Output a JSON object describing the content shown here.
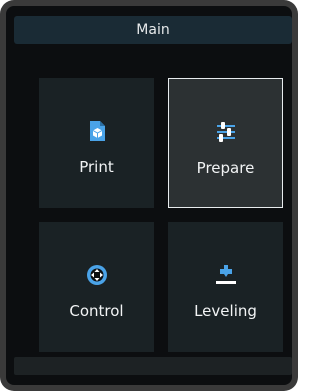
{
  "header": {
    "title": "Main"
  },
  "tiles": [
    {
      "label": "Print",
      "icon": "print-file-icon"
    },
    {
      "label": "Prepare",
      "icon": "sliders-icon",
      "selected": true
    },
    {
      "label": "Control",
      "icon": "dpad-icon"
    },
    {
      "label": "Leveling",
      "icon": "leveling-icon"
    }
  ],
  "colors": {
    "accent": "#4aa3e8",
    "header_bg": "#1a2b35",
    "tile_bg": "#1a2225",
    "selected_tile_bg": "#2c3133"
  }
}
